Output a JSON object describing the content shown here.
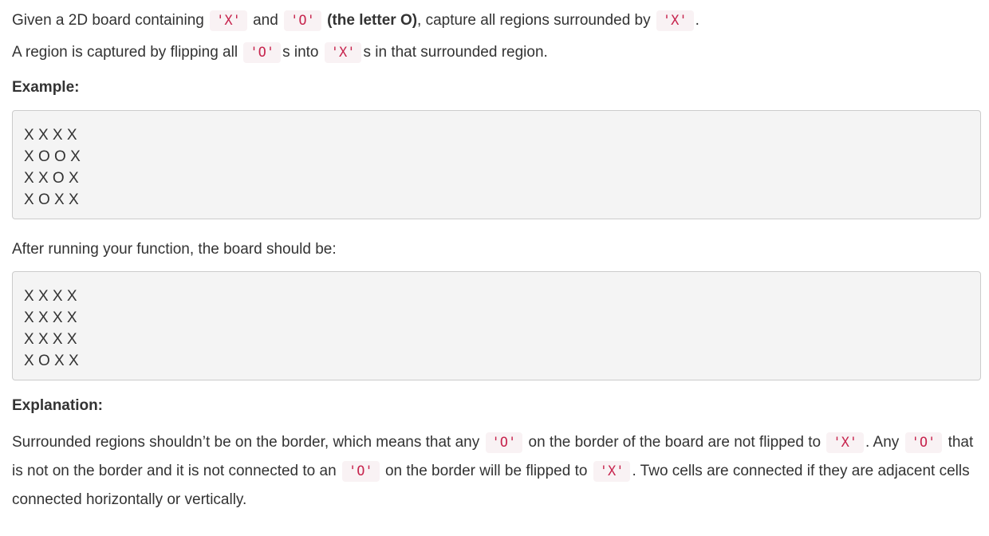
{
  "intro": {
    "t1": "Given a 2D board containing ",
    "c1": "'X'",
    "t2": " and ",
    "c2": "'O'",
    "t3": " ",
    "b1": "(the letter O)",
    "t4": ", capture all regions surrounded by ",
    "c3": "'X'",
    "t5": "."
  },
  "capture": {
    "t1": "A region is captured by flipping all ",
    "c1": "'O'",
    "t2": "s into ",
    "c2": "'X'",
    "t3": "s in that surrounded region."
  },
  "example_heading": "Example:",
  "example_board": "X X X X\nX O O X\nX X O X\nX O X X",
  "after_text": "After running your function, the board should be:",
  "result_board": "X X X X\nX X X X\nX X X X\nX O X X",
  "explanation_heading": "Explanation:",
  "explanation": {
    "t1": "Surrounded regions shouldn’t be on the border, which means that any ",
    "c1": "'O'",
    "t2": " on the border of the board are not flipped to ",
    "c2": "'X'",
    "t3": ". Any ",
    "c3": "'O'",
    "t4": " that is not on the border and it is not connected to an ",
    "c4": "'O'",
    "t5": " on the border will be flipped to ",
    "c5": "'X'",
    "t6": ". Two cells are connected if they are adjacent cells connected horizontally or vertically."
  }
}
